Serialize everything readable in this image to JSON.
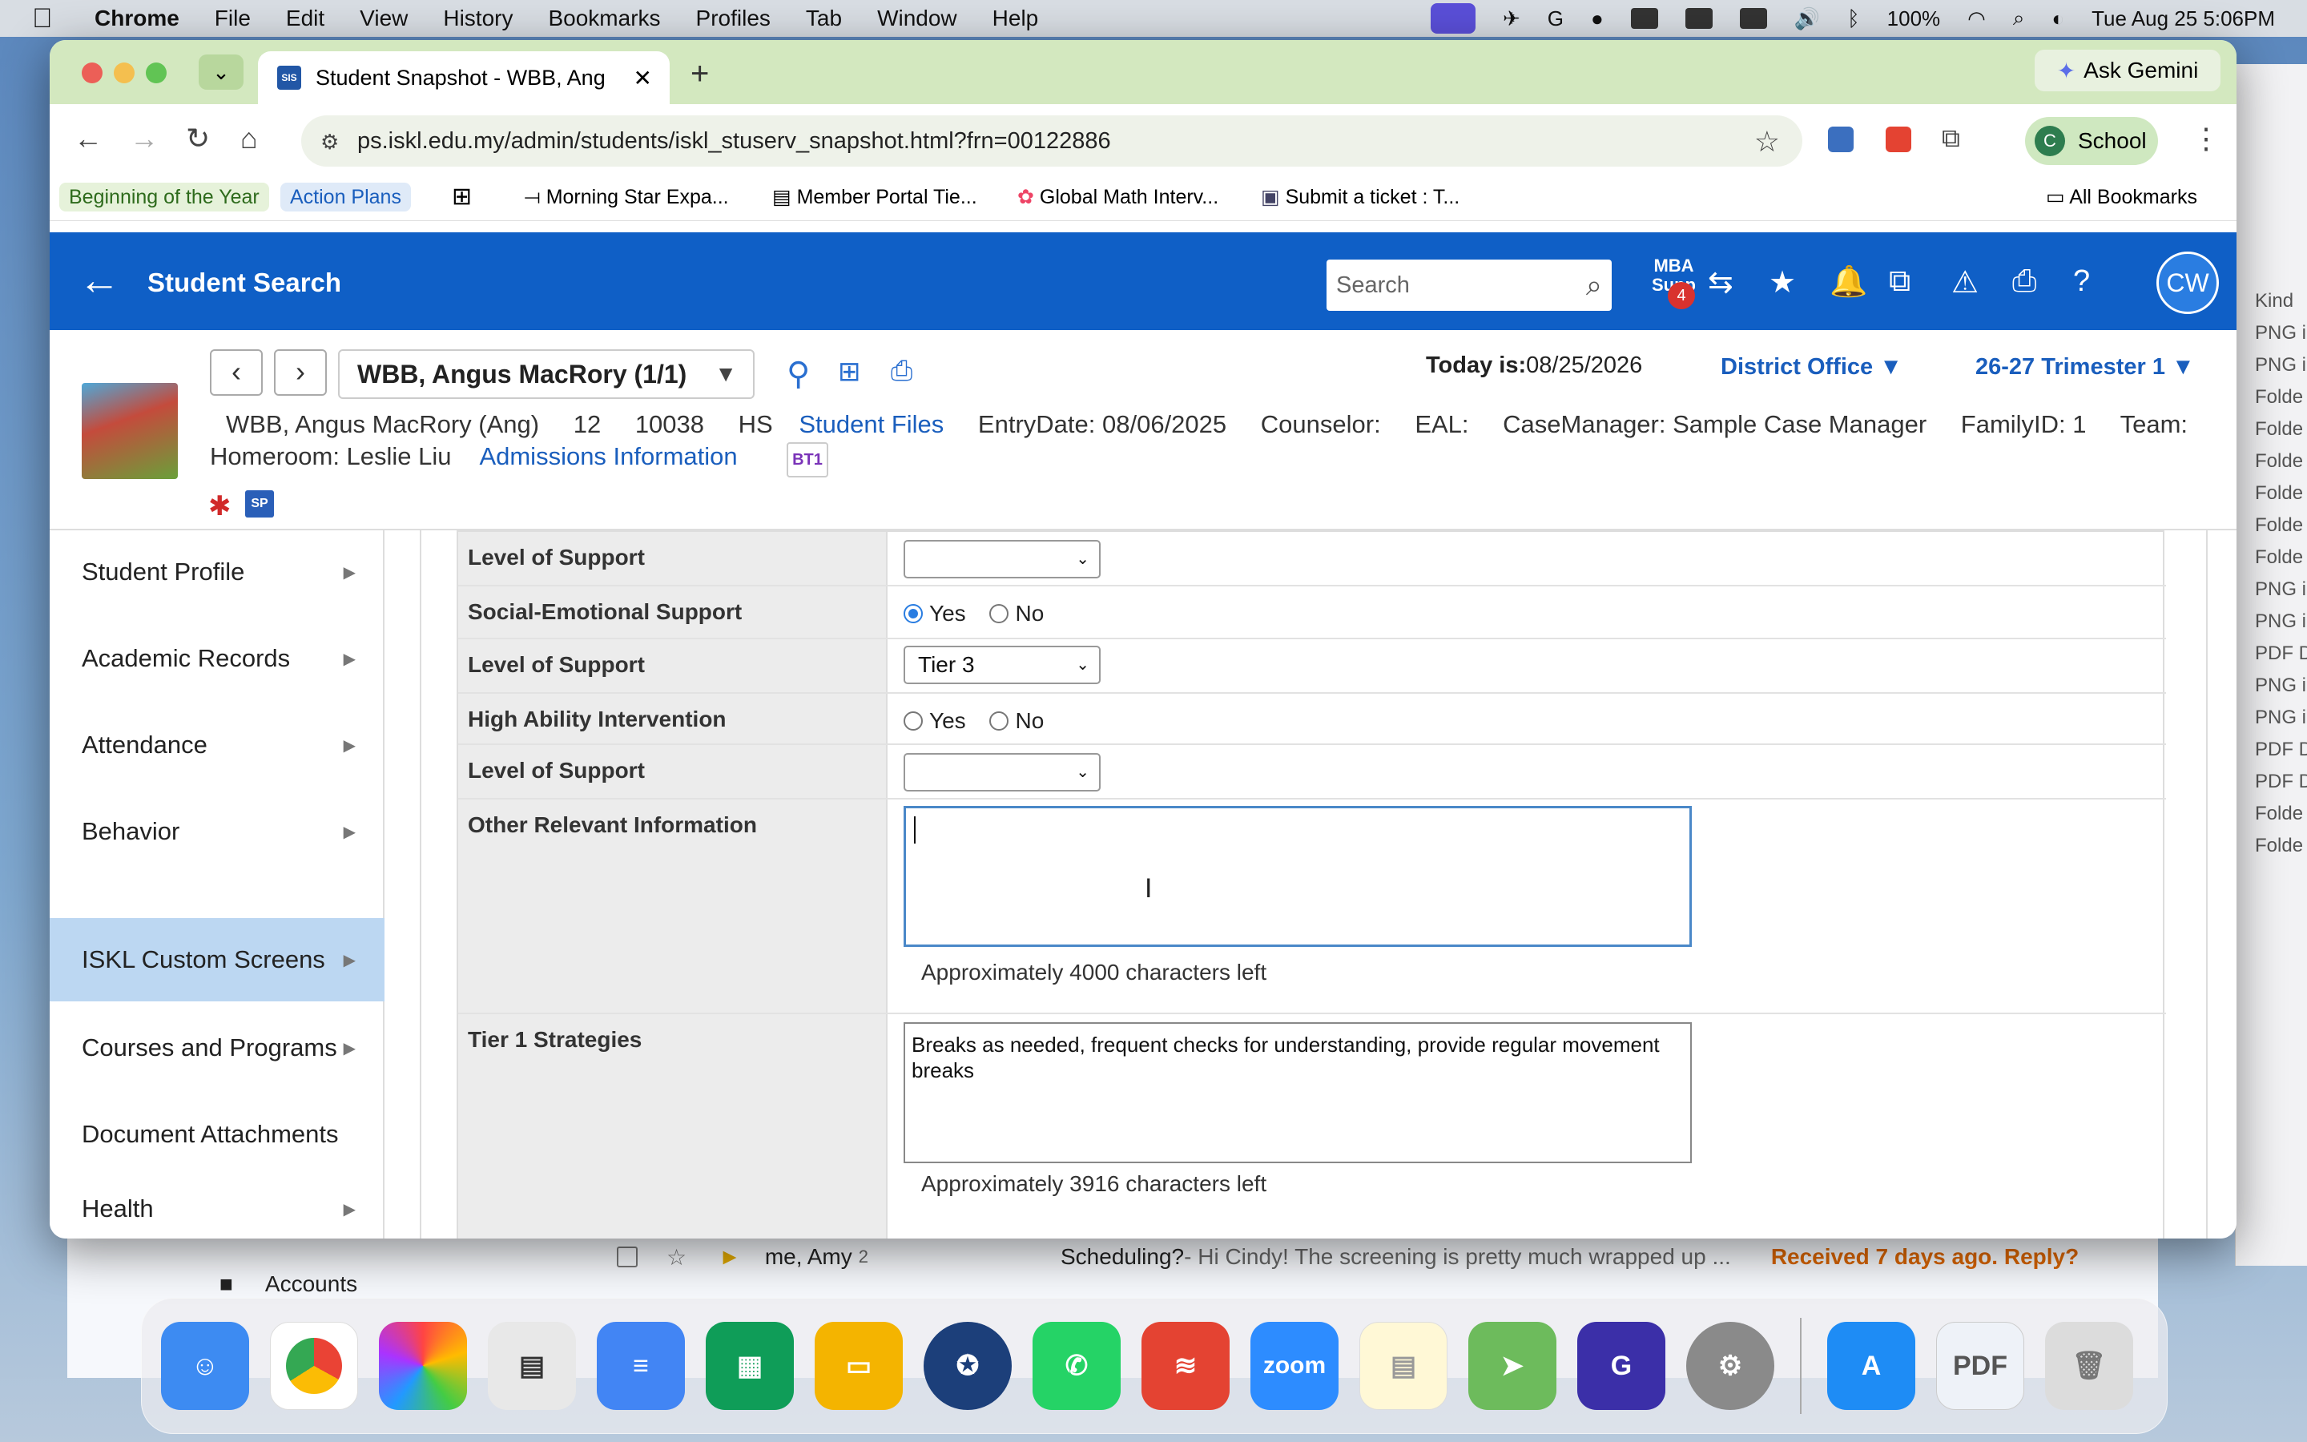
{
  "menubar": {
    "app": "Chrome",
    "items": [
      "File",
      "Edit",
      "View",
      "History",
      "Bookmarks",
      "Profiles",
      "Tab",
      "Window",
      "Help"
    ],
    "battery": "100%",
    "datetime": "Tue Aug 25  5:06PM"
  },
  "browser": {
    "tab_title": "Student Snapshot - WBB, Ang",
    "tab_favicon": "SIS",
    "ask_gemini": "Ask Gemini",
    "url": "ps.iskl.edu.my/admin/students/iskl_stuserv_snapshot.html?frn=00122886",
    "profile_initial": "C",
    "profile_label": "School",
    "bookmarks": [
      "Beginning of the Year",
      "Action Plans",
      "Morning Star Expa...",
      "Member Portal Tie...",
      "Global Math Interv...",
      "Submit a ticket : T..."
    ],
    "all_bookmarks": "All Bookmarks"
  },
  "ps_header": {
    "title": "Student Search",
    "search_placeholder": "Search",
    "mba_label": "MBA",
    "mba_sub": "Supp",
    "mba_badge": "4",
    "user_initials": "CW"
  },
  "student": {
    "selector": "WBB, Angus MacRory  (1/1)",
    "today_label": "Today is:",
    "today_value": "08/25/2026",
    "district": "District Office",
    "term": "26-27 Trimester 1",
    "full_name": "WBB, Angus MacRory (Ang)",
    "grade": "12",
    "id": "10038",
    "school": "HS",
    "student_files": "Student Files",
    "entry_date": "EntryDate: 08/06/2025",
    "counselor": "Counselor:",
    "eal": "EAL:",
    "case_manager": "CaseManager: Sample Case Manager",
    "family_id": "FamilyID: 1",
    "team": "Team:",
    "homeroom": "Homeroom: Leslie Liu",
    "admissions": "Admissions Information",
    "bt1_badge": "BT1",
    "sp_badge": "SP"
  },
  "sidebar": {
    "items": [
      {
        "label": "Student Profile",
        "arrow": "▶"
      },
      {
        "label": "Academic Records",
        "arrow": "▶"
      },
      {
        "label": "Attendance",
        "arrow": "▶"
      },
      {
        "label": "Behavior",
        "arrow": "▶"
      },
      {
        "label": "ISKL Custom Screens",
        "arrow": "▶"
      },
      {
        "label": "Courses and Programs",
        "arrow": "▶"
      },
      {
        "label": "Document Attachments",
        "arrow": ""
      },
      {
        "label": "Health",
        "arrow": "▶"
      }
    ]
  },
  "form": {
    "level_of_support_label": "Level of Support",
    "level1_value": "",
    "social_emotional_label": "Social-Emotional Support",
    "social_emotional_value": "Yes",
    "level2_value": "Tier 3",
    "high_ability_label": "High Ability Intervention",
    "high_ability_value": "",
    "level3_value": "",
    "yes_label": "Yes",
    "no_label": "No",
    "other_info_label": "Other Relevant Information",
    "other_info_value": "",
    "other_info_chars": "Approximately 4000 characters left",
    "tier1_label": "Tier 1 Strategies",
    "tier1_value": "Breaks as needed, frequent checks for understanding, provide regular movement breaks",
    "tier1_chars": "Approximately 3916 characters left"
  },
  "gmail": {
    "row1_sender": "me, Amy",
    "row1_count": "2",
    "row1_subject": "Scheduling?",
    "row1_snippet": " - Hi Cindy! The screening is pretty much wrapped up ...",
    "row1_status": "Received 7 days ago. Reply?",
    "accounts_label": "Accounts"
  },
  "finder_strip": [
    "Kind",
    "PNG i",
    "PNG i",
    "Folde",
    "Folde",
    "Folde",
    "Folde",
    "Folde",
    "Folde",
    "PNG i",
    "PNG i",
    "PDF D",
    "PNG i",
    "PNG i",
    "PDF D",
    "PDF D",
    "Folde",
    "Folde"
  ],
  "dock": {
    "zoom_label": "zoom"
  }
}
